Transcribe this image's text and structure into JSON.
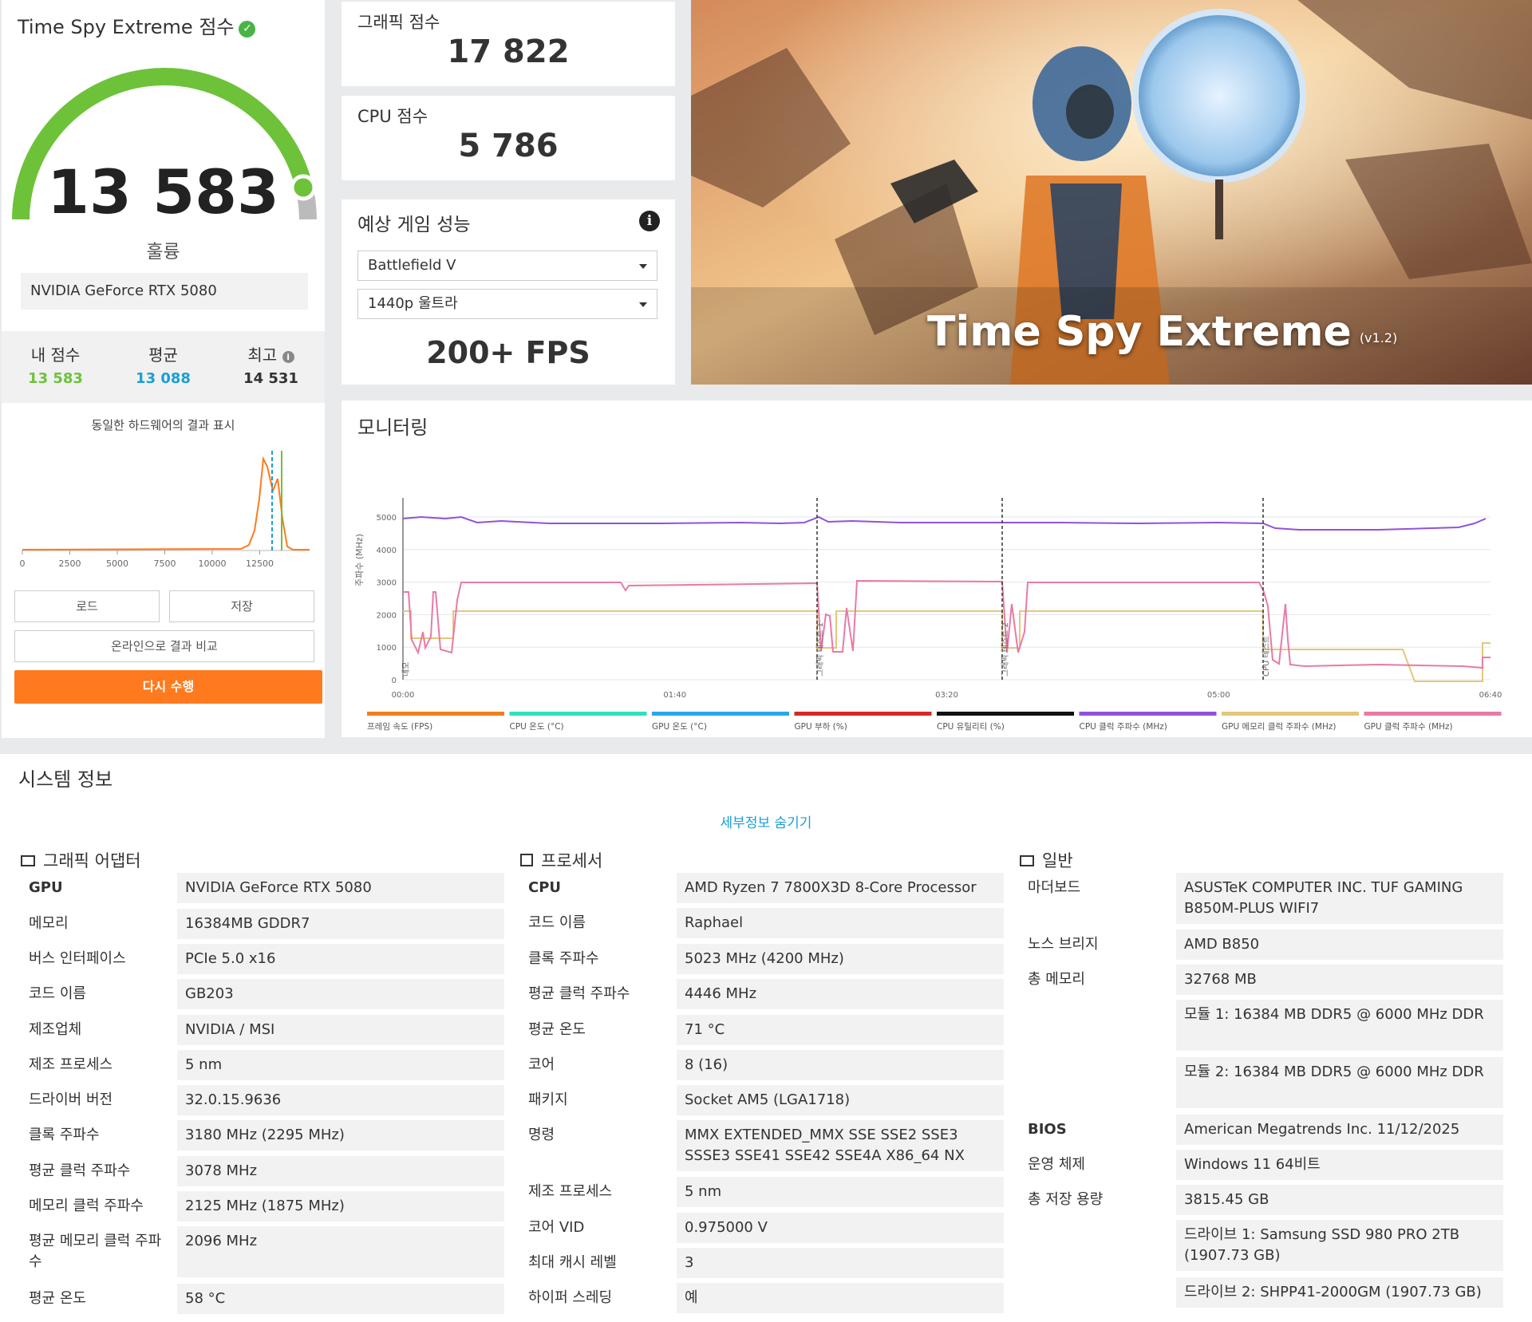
{
  "score_panel": {
    "title": "Time Spy Extreme 점수",
    "score": "13 583",
    "rating": "훌륭",
    "gpu_name": "NVIDIA GeForce RTX 5080",
    "stats": {
      "my_label": "내 점수",
      "my_value": "13 583",
      "avg_label": "평균",
      "avg_value": "13 088",
      "best_label": "최고",
      "best_value": "14 531"
    },
    "dist_caption": "동일한 하드웨어의 결과 표시",
    "dist_ticks": [
      "0",
      "2500",
      "5000",
      "7500",
      "10000",
      "12500"
    ],
    "load_label": "로드",
    "save_label": "저장",
    "compare_label": "온라인으로 결과 비교",
    "rerun_label": "다시 수행",
    "colors": {
      "green": "#6dc23a",
      "orange": "#ff7a1f",
      "blue": "#1a9fd4"
    }
  },
  "graphics_score": {
    "label": "그래픽 점수",
    "value": "17 822"
  },
  "cpu_score": {
    "label": "CPU 점수",
    "value": "5 786"
  },
  "game_perf": {
    "label": "예상 게임 성능",
    "game": "Battlefield V",
    "preset": "1440p 울트라",
    "fps": "200+ FPS"
  },
  "hero": {
    "title": "Time Spy Extreme",
    "version": "(v1.2)"
  },
  "monitoring": {
    "title": "모니터링",
    "y_label": "주파수 (MHz)",
    "y_ticks": [
      "0",
      "1000",
      "2000",
      "3000",
      "4000",
      "5000"
    ],
    "x_ticks": [
      "00:00",
      "01:40",
      "03:20",
      "05:00",
      "06:40"
    ],
    "markers": [
      "데모",
      "그래픽 테스트 1",
      "그래픽 테스트 2",
      "CPU 테스트"
    ],
    "legend": [
      {
        "label": "프레임 속도 (FPS)",
        "color": "#f07f1e"
      },
      {
        "label": "CPU 온도 (°C)",
        "color": "#2fe0c0"
      },
      {
        "label": "GPU 온도 (°C)",
        "color": "#27a9e6"
      },
      {
        "label": "GPU 부하 (%)",
        "color": "#d32a2a"
      },
      {
        "label": "CPU 유틸리티 (%)",
        "color": "#111111"
      },
      {
        "label": "CPU 클럭 주파수 (MHz)",
        "color": "#9153d6"
      },
      {
        "label": "GPU 메모리 클럭 주파수 (MHz)",
        "color": "#e3c77a"
      },
      {
        "label": "GPU 클럭 주파수 (MHz)",
        "color": "#e87aa8"
      }
    ]
  },
  "sysinfo": {
    "title": "시스템 정보",
    "hide_details": "세부정보 숨기기",
    "gpu": {
      "heading": "그래픽 어댑터",
      "rows": [
        {
          "label": "GPU",
          "value": "NVIDIA GeForce RTX 5080"
        },
        {
          "label": "메모리",
          "value": "16384MB GDDR7"
        },
        {
          "label": "버스 인터페이스",
          "value": "PCIe 5.0 x16"
        },
        {
          "label": "코드 이름",
          "value": "GB203"
        },
        {
          "label": "제조업체",
          "value": "NVIDIA / MSI"
        },
        {
          "label": "제조 프로세스",
          "value": "5 nm"
        },
        {
          "label": "드라이버 버전",
          "value": "32.0.15.9636"
        },
        {
          "label": "클록 주파수",
          "value": "3180 MHz (2295 MHz)"
        },
        {
          "label": "평균 클럭 주파수",
          "value": "3078 MHz"
        },
        {
          "label": "메모리 클럭 주파수",
          "value": "2125 MHz (1875 MHz)"
        },
        {
          "label": "평균 메모리 클럭 주파수",
          "value": "2096 MHz"
        },
        {
          "label": "평균 온도",
          "value": "58 °C"
        }
      ]
    },
    "cpu": {
      "heading": "프로세서",
      "rows": [
        {
          "label": "CPU",
          "value": "AMD Ryzen 7 7800X3D 8-Core Processor"
        },
        {
          "label": "코드 이름",
          "value": "Raphael"
        },
        {
          "label": "클록 주파수",
          "value": "5023 MHz (4200 MHz)"
        },
        {
          "label": "평균 클럭 주파수",
          "value": "4446 MHz"
        },
        {
          "label": "평균 온도",
          "value": "71 °C"
        },
        {
          "label": "코어",
          "value": "8 (16)"
        },
        {
          "label": "패키지",
          "value": "Socket AM5 (LGA1718)"
        },
        {
          "label": "명령",
          "value": "MMX EXTENDED_MMX SSE SSE2 SSE3 SSSE3 SSE41 SSE42 SSE4A X86_64 NX"
        },
        {
          "label": "제조 프로세스",
          "value": "5 nm"
        },
        {
          "label": "코어 VID",
          "value": "0.975000 V"
        },
        {
          "label": "최대 캐시 레벨",
          "value": "3"
        },
        {
          "label": "하이퍼 스레딩",
          "value": "예"
        }
      ]
    },
    "general": {
      "heading": "일반",
      "rows": [
        {
          "label": "마더보드",
          "value": "ASUSTeK COMPUTER INC. TUF GAMING B850M-PLUS WIFI7"
        },
        {
          "label": "노스 브리지",
          "value": "AMD B850"
        },
        {
          "label": "총 메모리",
          "value": "32768 MB"
        },
        {
          "label": "",
          "value": "모듈 1: 16384 MB DDR5 @ 6000 MHz DDR"
        },
        {
          "label": "",
          "value": "모듈 2: 16384 MB DDR5 @ 6000 MHz DDR"
        },
        {
          "label": "BIOS",
          "value": "American Megatrends Inc. 11/12/2025"
        },
        {
          "label": "운영 체제",
          "value": "Windows 11 64비트"
        },
        {
          "label": "총 저장 용량",
          "value": "3815.45 GB"
        },
        {
          "label": "",
          "value": "드라이브 1: Samsung SSD 980 PRO 2TB (1907.73 GB)"
        },
        {
          "label": "",
          "value": "드라이브 2: SHPP41-2000GM (1907.73 GB)"
        }
      ]
    }
  }
}
